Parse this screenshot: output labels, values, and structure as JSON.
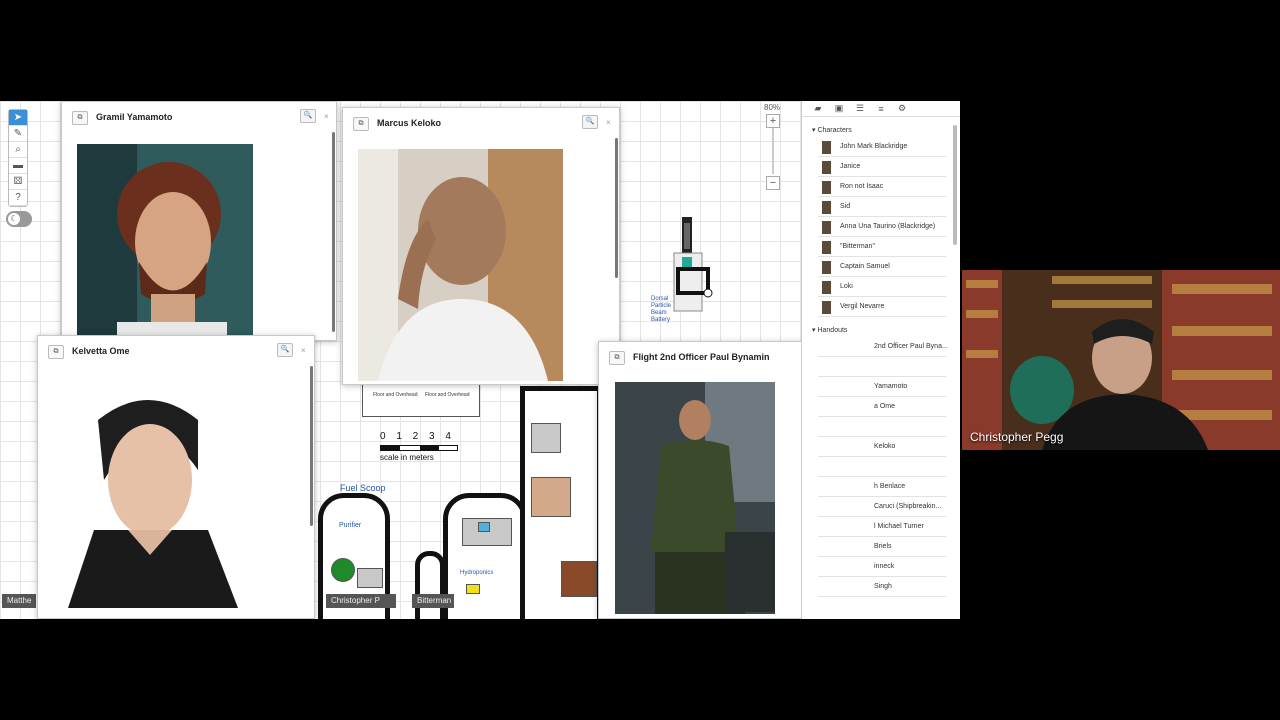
{
  "toolbar": {
    "tools": [
      "select-arrow-icon",
      "draw-pencil-icon",
      "zoom-magnifier-icon",
      "ruler-icon",
      "dice-icon",
      "help-icon"
    ],
    "toggle_icon": "moon-icon"
  },
  "zoom": {
    "percent": "80%",
    "plus": "+",
    "minus": "−"
  },
  "map": {
    "scale_numbers": "0 1 2 3 4",
    "scale_label": "scale in meters",
    "fuel_scoop": "Fuel Scoop",
    "purifier": "Purifier",
    "hydroponics": "Hydroponics",
    "legend_a": "Floor and Overhead",
    "legend_b": "Floor and Overhead",
    "small_label": "Dorsal Particle Beam Battery"
  },
  "token_tags": [
    "Matthe",
    "Christopher P",
    "Bitterman"
  ],
  "windows": {
    "gramil": {
      "title": "Gramil Yamamoto"
    },
    "marcus": {
      "title": "Marcus Keloko"
    },
    "kelvetta": {
      "title": "Kelvetta Ome"
    },
    "paul": {
      "title": "Flight 2nd Officer Paul Bynamin"
    }
  },
  "window_buttons": {
    "popout": "⧉",
    "zoom": "🔍",
    "close": "×"
  },
  "sidebar": {
    "tabs": [
      "chat-icon",
      "art-icon",
      "journal-icon",
      "list-icon",
      "gear-icon"
    ],
    "characters_header": "▾ Characters",
    "characters": [
      "John Mark Blackridge",
      "Janice",
      "Ron not Isaac",
      "Sid",
      "Anna Una Taurino (Blackridge)",
      "\"Bitterman\"",
      "Captain Samuel",
      "Loki",
      "Vergil Nevarre"
    ],
    "handouts_header": "▾ Handouts",
    "handouts_visible": [
      "2nd Officer Paul Byna...",
      "",
      "Yamamoto",
      "a Ome",
      "",
      "Keloko",
      "",
      "h Benlace",
      "Caruci (Shipbreakin...",
      "l Michael Turner",
      "Briels",
      "inneck",
      "Singh"
    ]
  },
  "webcam": {
    "name": "Christopher Pegg"
  }
}
